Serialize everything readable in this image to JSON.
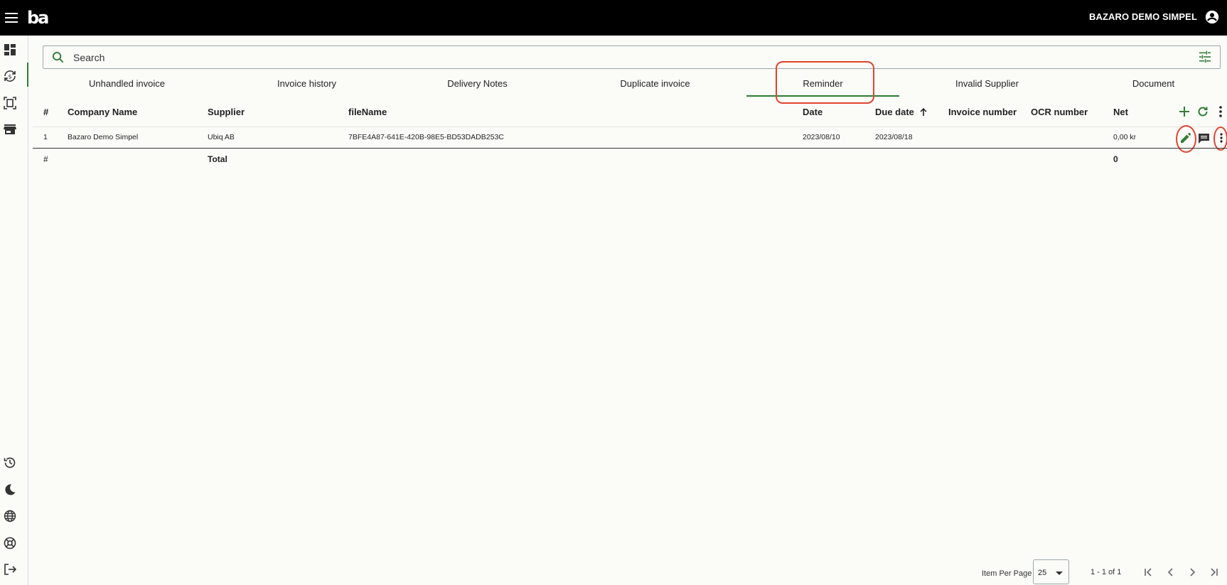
{
  "header": {
    "logo": "ba",
    "organization": "BAZARO DEMO SIMPEL"
  },
  "search": {
    "placeholder": "Search"
  },
  "tabs": [
    {
      "label": "Unhandled invoice"
    },
    {
      "label": "Invoice history"
    },
    {
      "label": "Delivery Notes"
    },
    {
      "label": "Duplicate invoice"
    },
    {
      "label": "Reminder",
      "active": true
    },
    {
      "label": "Invalid Supplier"
    },
    {
      "label": "Document"
    }
  ],
  "table": {
    "columns": {
      "index": "#",
      "company": "Company Name",
      "supplier": "Supplier",
      "filename": "fileName",
      "date": "Date",
      "due_date": "Due date",
      "invoice_number": "Invoice number",
      "ocr_number": "OCR number",
      "net": "Net"
    },
    "rows": [
      {
        "index": "1",
        "company": "Bazaro Demo Simpel",
        "supplier": "Ubiq AB",
        "filename": "7BFE4A87-641E-420B-98E5-BD53DADB253C",
        "date": "2023/08/10",
        "due_date": "2023/08/18",
        "invoice_number": "",
        "ocr_number": "",
        "net": "0,00 kr"
      }
    ],
    "footer": {
      "index": "#",
      "label": "Total",
      "net": "0"
    }
  },
  "pagination": {
    "items_per_page_label": "Item Per Page",
    "items_per_page": "25",
    "range": "1 - 1 of 1"
  },
  "colors": {
    "accent": "#2e7d32",
    "highlight": "#e0442f",
    "topbar": "#000000"
  }
}
